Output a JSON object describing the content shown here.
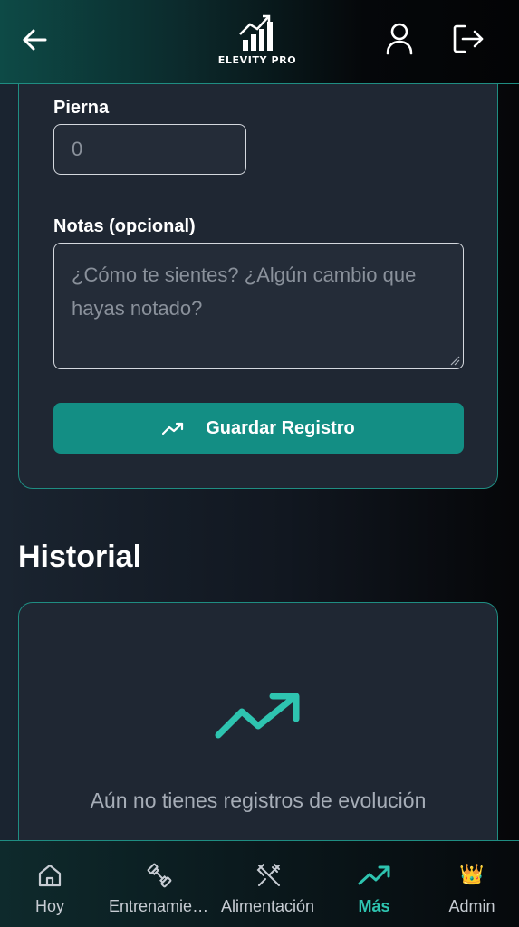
{
  "header": {
    "logo_text": "ELEVITY PRO",
    "back_icon": "arrow-left-icon",
    "profile_icon": "user-icon",
    "logout_icon": "logout-icon"
  },
  "form": {
    "leg_label": "Pierna",
    "leg_placeholder": "0",
    "notes_label": "Notas (opcional)",
    "notes_placeholder": "¿Cómo te sientes? ¿Algún cambio que hayas notado?",
    "save_label": "Guardar Registro",
    "save_icon": "trending-up-icon"
  },
  "history": {
    "title": "Historial",
    "empty_icon": "trending-up-icon",
    "empty_text": "Aún no tienes registros de evolución"
  },
  "bottom_nav": {
    "items": [
      {
        "label": "Hoy",
        "icon": "home-icon",
        "active": false
      },
      {
        "label": "Entrenamiento",
        "icon": "dumbbell-icon",
        "active": false
      },
      {
        "label": "Alimentación",
        "icon": "utensils-icon",
        "active": false
      },
      {
        "label": "Más",
        "icon": "trending-up-icon",
        "active": true
      },
      {
        "label": "Admin",
        "icon": "crown-icon",
        "active": false
      }
    ]
  },
  "colors": {
    "accent": "#2ec4b0",
    "button": "#138e84",
    "card": "#1f2733",
    "border": "#1f8d82"
  }
}
